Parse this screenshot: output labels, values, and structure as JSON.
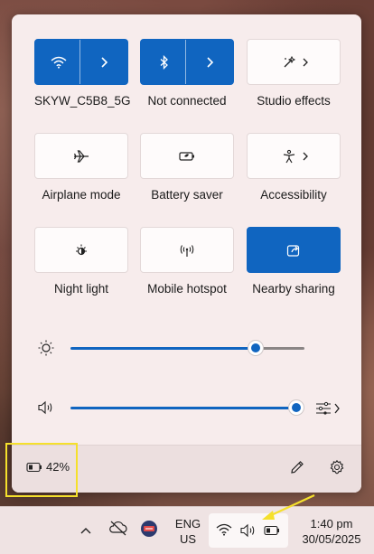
{
  "quick_settings": {
    "tiles": [
      {
        "label": "SKYW_C5B8_5G",
        "icon": "wifi-icon",
        "state": "on",
        "has_chevron": true
      },
      {
        "label": "Not connected",
        "icon": "bluetooth-icon",
        "state": "on",
        "has_chevron": true
      },
      {
        "label": "Studio effects",
        "icon": "studio-effects-icon",
        "state": "off",
        "has_chevron": true
      },
      {
        "label": "Airplane mode",
        "icon": "airplane-icon",
        "state": "off",
        "has_chevron": false
      },
      {
        "label": "Battery saver",
        "icon": "battery-saver-icon",
        "state": "off",
        "has_chevron": false
      },
      {
        "label": "Accessibility",
        "icon": "accessibility-icon",
        "state": "off",
        "has_chevron": true
      },
      {
        "label": "Night light",
        "icon": "night-light-icon",
        "state": "off",
        "has_chevron": false
      },
      {
        "label": "Mobile hotspot",
        "icon": "mobile-hotspot-icon",
        "state": "off",
        "has_chevron": false
      },
      {
        "label": "Nearby sharing",
        "icon": "nearby-sharing-icon",
        "state": "on",
        "has_chevron": false
      }
    ],
    "brightness": {
      "icon": "brightness-icon",
      "level_fraction": 0.79
    },
    "volume": {
      "icon": "speaker-icon",
      "level_fraction": 1.0,
      "mixer_icon": "audio-mixer-icon"
    },
    "footer": {
      "battery_percent": "42%",
      "battery_icon": "battery-icon",
      "edit_icon": "pencil-icon",
      "settings_icon": "gear-icon"
    }
  },
  "taskbar": {
    "chevron_icon": "chevron-up-icon",
    "cloud_icon": "cloud-offline-icon",
    "app_icon": "app-tray-icon",
    "language_line1": "ENG",
    "language_line2": "US",
    "network_icon": "wifi-icon",
    "volume_icon": "speaker-icon",
    "battery_icon": "battery-icon",
    "time": "1:40 pm",
    "date": "30/05/2025"
  },
  "colors": {
    "accent": "#1065c0",
    "panel_bg": "#f7ecec",
    "annotation_yellow": "#f5e02c"
  }
}
